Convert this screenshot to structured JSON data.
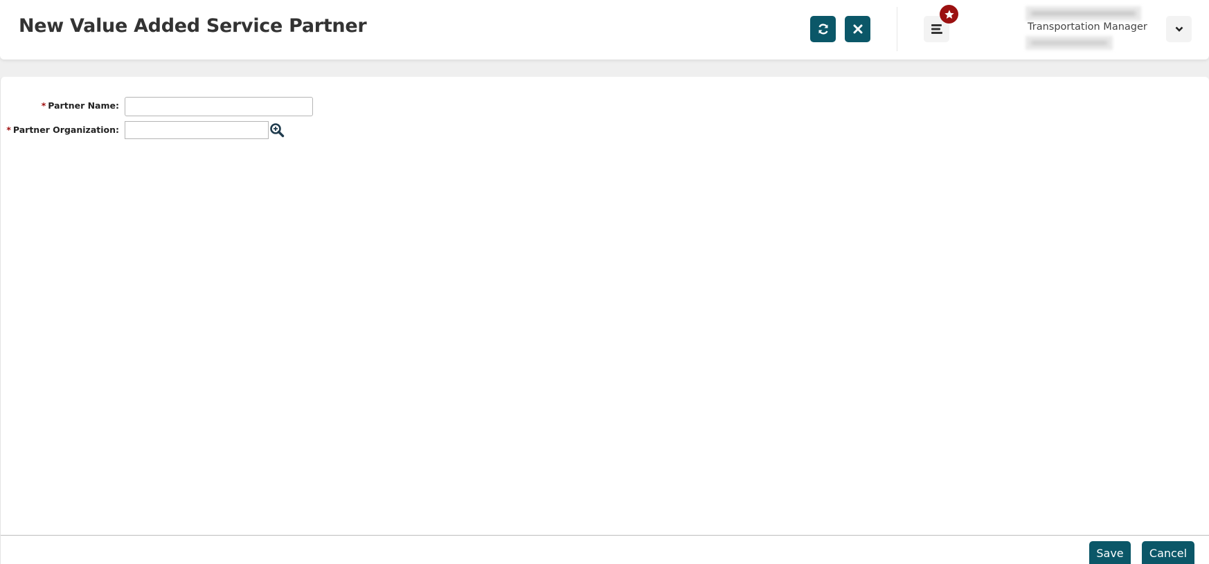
{
  "header": {
    "title": "New Value Added Service Partner",
    "buttons": [
      {
        "name": "refresh",
        "icon": "refresh-icon"
      },
      {
        "name": "close",
        "icon": "close-icon"
      },
      {
        "name": "menu",
        "icon": "menu-icon"
      },
      {
        "name": "user-dropdown",
        "icon": "chevron-down-icon"
      }
    ],
    "favorites_badge_icon": "star-icon",
    "user": {
      "name": "(blurred)",
      "role": "Transportation Manager",
      "subtitle": "(blurred)"
    }
  },
  "form": {
    "fields": [
      {
        "label": "Partner Name:",
        "required_marker": "*",
        "value": "",
        "placeholder": ""
      },
      {
        "label": "Partner Organization:",
        "required_marker": "*",
        "value": "",
        "placeholder": "",
        "lookup_icon": "search-plus-icon"
      }
    ]
  },
  "footer": {
    "save_label": "Save",
    "cancel_label": "Cancel"
  },
  "colors": {
    "accent": "#0b5768",
    "badge": "#9b1010",
    "required": "#a01010"
  }
}
